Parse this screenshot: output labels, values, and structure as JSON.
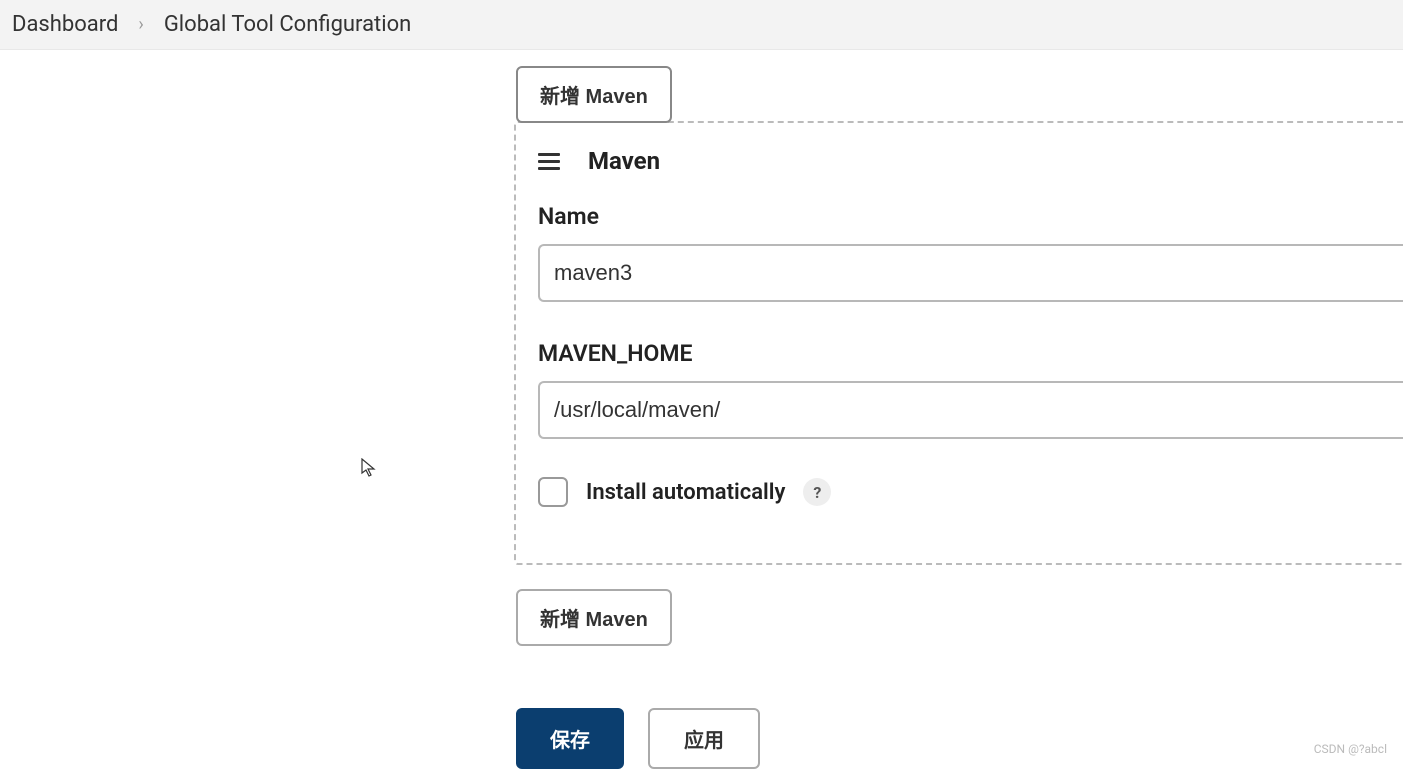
{
  "breadcrumb": {
    "dashboard": "Dashboard",
    "current": "Global Tool Configuration"
  },
  "buttons": {
    "add_maven_top": "新增 Maven",
    "add_maven_bottom": "新增 Maven",
    "save": "保存",
    "apply": "应用"
  },
  "section": {
    "title": "Maven",
    "name_label": "Name",
    "name_value": "maven3",
    "home_label": "MAVEN_HOME",
    "home_value": "/usr/local/maven/",
    "install_auto_label": "Install automatically",
    "help_symbol": "?"
  },
  "watermark": "CSDN @?abcl"
}
